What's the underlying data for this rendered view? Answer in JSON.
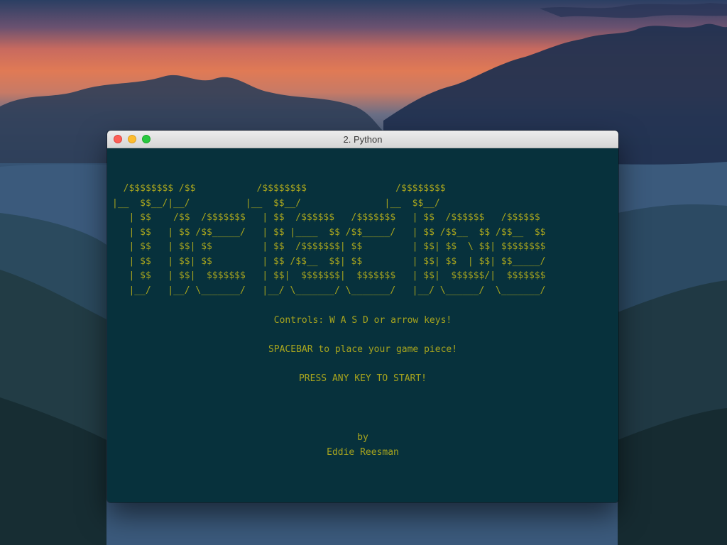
{
  "window": {
    "title": "2. Python",
    "controls": [
      "close",
      "minimize",
      "zoom"
    ]
  },
  "terminal": {
    "ascii_art": [
      "  /$$$$$$$$ /$$           /$$$$$$$$                /$$$$$$$$",
      "|__  $$__/|__/          |__  $$__/               |__  $$__/",
      "   | $$    /$$  /$$$$$$$   | $$  /$$$$$$   /$$$$$$$   | $$  /$$$$$$   /$$$$$$",
      "   | $$   | $$ /$$_____/   | $$ |____  $$ /$$_____/   | $$ /$$__  $$ /$$__  $$",
      "   | $$   | $$| $$         | $$  /$$$$$$$| $$         | $$| $$  \\ $$| $$$$$$$$",
      "   | $$   | $$| $$         | $$ /$$__  $$| $$         | $$| $$  | $$| $$_____/",
      "   | $$   | $$|  $$$$$$$   | $$|  $$$$$$$|  $$$$$$$   | $$|  $$$$$$/|  $$$$$$$",
      "   |__/   |__/ \\_______/   |__/ \\_______/ \\_______/   |__/ \\______/  \\_______/"
    ],
    "controls_line": "Controls: W A S D or arrow keys!",
    "spacebar_line": "SPACEBAR to place your game piece!",
    "start_line": "PRESS ANY KEY TO START!",
    "by_line": "by",
    "author_line": "Eddie Reesman"
  },
  "colors": {
    "terminal_bg": "#07313c",
    "terminal_text": "#a7a41e"
  }
}
